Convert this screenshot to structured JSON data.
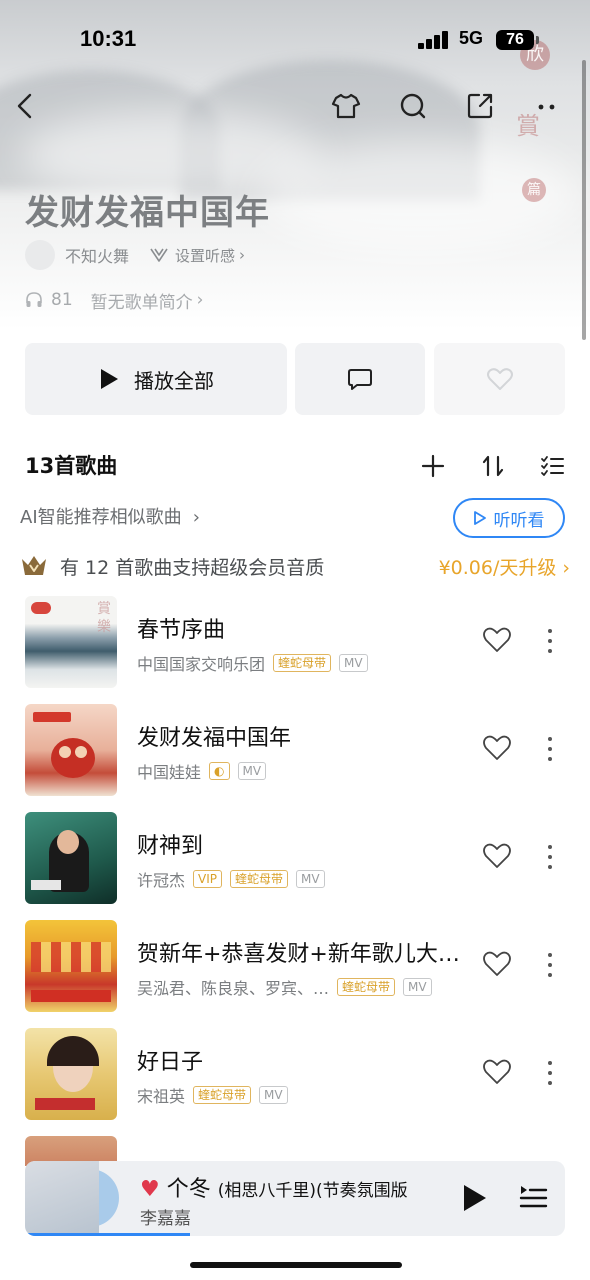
{
  "status_bar": {
    "time": "10:31",
    "network": "5G",
    "battery": "76"
  },
  "playlist": {
    "title": "发财发福中国年",
    "creator": "不知火舞",
    "set_feel": "设置听感",
    "play_count": "81",
    "description": "暂无歌单简介"
  },
  "actions": {
    "play_all": "播放全部"
  },
  "list": {
    "count_label": "13首歌曲",
    "ai_recommend": "AI智能推荐相似歌曲",
    "listen_button": "听听看",
    "vip_text": "有 12 首歌曲支持超级会员音质",
    "upgrade_text": "¥0.06/天升级"
  },
  "songs": [
    {
      "title": "春节序曲",
      "artist": "中国国家交响乐团",
      "tags": [
        "蝰蛇母带",
        "MV"
      ],
      "cover": "teal"
    },
    {
      "title": "发财发福中国年",
      "artist": "中国娃娃",
      "tags": [
        "◐",
        "MV"
      ],
      "cover": "red"
    },
    {
      "title": "财神到",
      "artist": "许冠杰",
      "tags": [
        "VIP",
        "蝰蛇母带",
        "MV"
      ],
      "cover": "green"
    },
    {
      "title": "贺新年+恭喜发财+新年歌儿大…",
      "artist": "吴泓君、陈良泉、罗宾、…",
      "tags": [
        "蝰蛇母带",
        "MV"
      ],
      "cover": "yellow"
    },
    {
      "title": "好日子",
      "artist": "宋祖英",
      "tags": [
        "蝰蛇母带",
        "MV"
      ],
      "cover": "gold"
    }
  ],
  "now_playing": {
    "title": "个冬",
    "subtitle": "(相思八千里)(节奏氛围版",
    "artist": "李嘉嘉"
  }
}
